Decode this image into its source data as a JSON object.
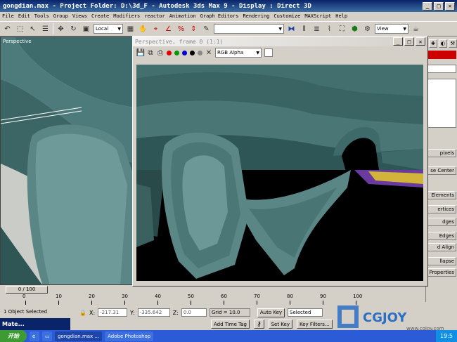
{
  "window": {
    "title": "gongdian.max    - Project Folder: D:\\3d_F      - Autodesk 3ds Max 9      - Display : Direct 3D"
  },
  "menu": [
    "File",
    "Edit",
    "Tools",
    "Group",
    "Views",
    "Create",
    "Modifiers",
    "reactor",
    "Animation",
    "Graph Editors",
    "Rendering",
    "Customize",
    "MAXScript",
    "Help"
  ],
  "toolbar": {
    "coord_system": "Local",
    "view_combo": "View"
  },
  "viewport": {
    "label": "Perspective"
  },
  "render_window": {
    "title": "Perspective, frame 0 (1:1)",
    "channel": "RGB Alpha"
  },
  "command_panel": {
    "items": [
      "pixels",
      "se Center",
      "Elements",
      "ertices",
      "dges",
      "Edges",
      "d Align",
      "llapse",
      "Surface Properties"
    ]
  },
  "timeline": {
    "frame": "0 / 100",
    "ticks": [
      "0",
      "10",
      "20",
      "30",
      "40",
      "50",
      "60",
      "70",
      "80",
      "90",
      "100"
    ]
  },
  "status": {
    "selection": "1 Object Selected",
    "x_label": "X:",
    "x_value": "-217.31",
    "y_label": "Y:",
    "y_value": "-335.642",
    "z_label": "Z:",
    "z_value": "0.0",
    "grid": "Grid = 10.0",
    "add_time_tag": "Add Time Tag",
    "auto_key": "Auto Key",
    "selected": "Selected",
    "set_key": "Set Key",
    "key_filters": "Key Filters..."
  },
  "mini_window": {
    "title": "Mate..."
  },
  "taskbar": {
    "start": "开始",
    "tasks": [
      "gongdian.max ...",
      "Adobe Photoshop"
    ],
    "clock": "19:5"
  },
  "logo": {
    "brand": "CGJOY",
    "url": "www.cgjoy.com"
  },
  "colors": {
    "title_bar": "#0a246a",
    "viewport_bg": "#b6b9b4",
    "roof_tile": "#3f6b6b",
    "taskbar": "#2b5bd6"
  }
}
